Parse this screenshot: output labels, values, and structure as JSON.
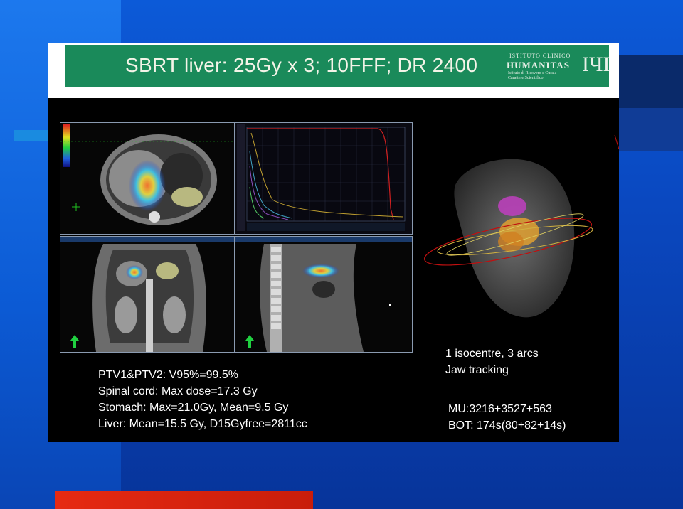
{
  "slide": {
    "title": "SBRT liver: 25Gy x 3; 10FFF; DR 2400",
    "logo": {
      "line1": "ISTITUTO CLINICO",
      "line2": "HUMANITAS",
      "line3": "Istituto di Ricovero e Cura a Carattere Scientifico",
      "mark": "IЧI"
    },
    "stats_left": [
      "PTV1&PTV2: V95%=99.5%",
      "Spinal cord: Max dose=17.3 Gy",
      "Stomach: Max=21.0Gy, Mean=9.5 Gy",
      "Liver: Mean=15.5 Gy, D15Gyfree=2811cc"
    ],
    "stats_right_top": [
      "1 isocentre, 3 arcs",
      "Jaw tracking"
    ],
    "stats_right_bottom": [
      "MU:3216+3527+563",
      "BOT: 174s(80+82+14s)"
    ]
  },
  "colors": {
    "title_band": "#1a8a5a",
    "background": "#0a48c0",
    "accent_red": "#e62a12"
  }
}
